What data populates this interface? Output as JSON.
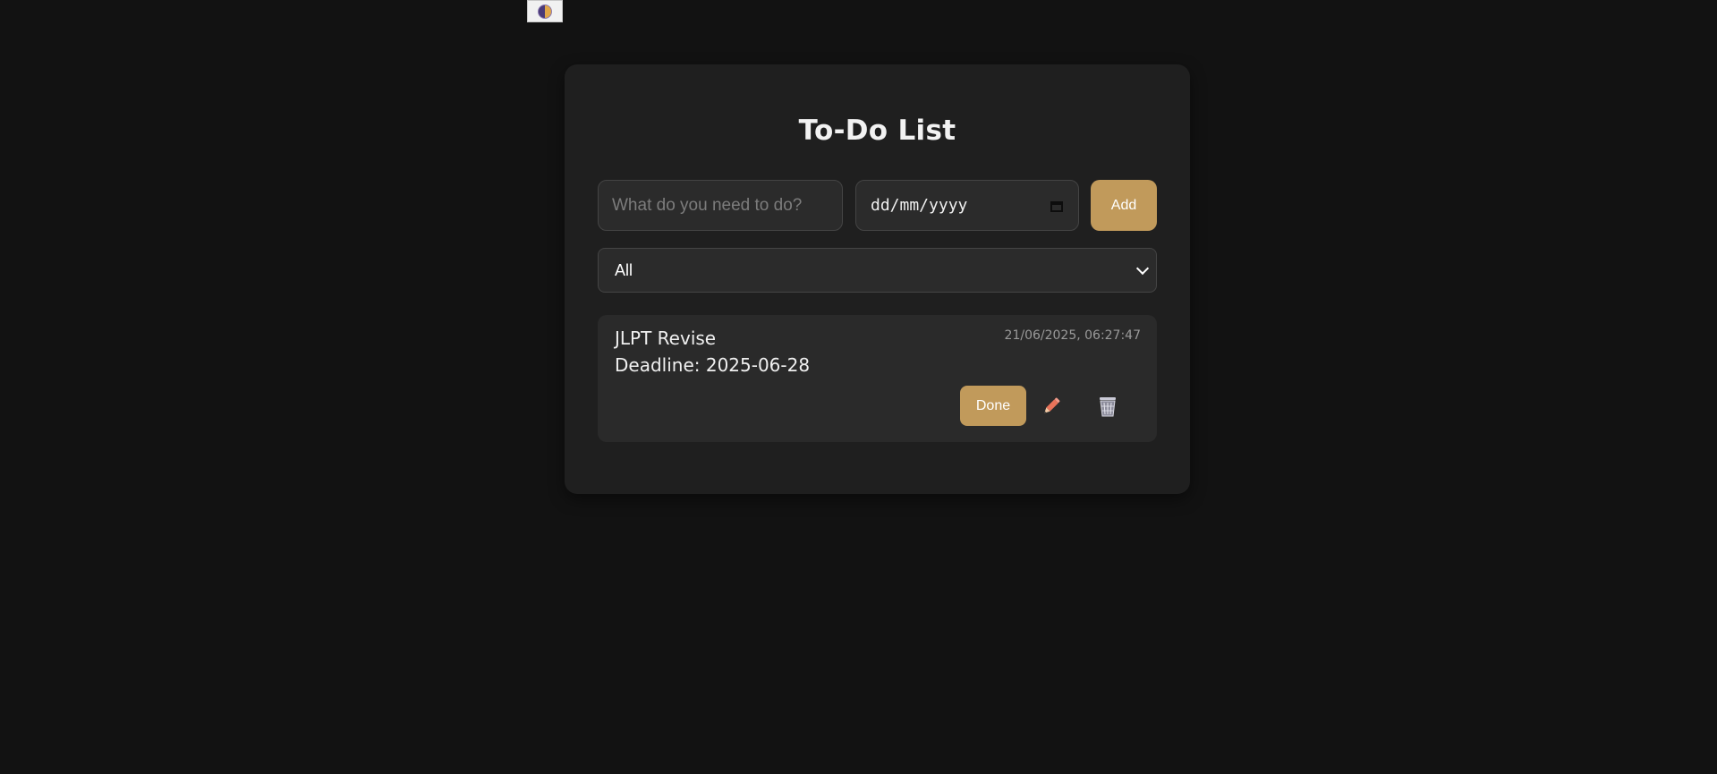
{
  "theme_toggle": {
    "icon": "half-moon-icon"
  },
  "app": {
    "title": "To-Do List"
  },
  "form": {
    "task_placeholder": "What do you need to do?",
    "task_value": "",
    "date_value": "dd/mm/yyyy",
    "add_label": "Add"
  },
  "filter": {
    "selected": "All"
  },
  "tasks": [
    {
      "name": "JLPT Revise",
      "deadline": "Deadline: 2025-06-28",
      "created": "21/06/2025, 06:27:47",
      "done_label": "Done",
      "edit_icon": "pencil-icon",
      "delete_icon": "trash-icon"
    }
  ],
  "colors": {
    "background": "#121212",
    "card": "#1f1f1f",
    "accent": "#c19a5b",
    "pencil": "#e9735a"
  }
}
